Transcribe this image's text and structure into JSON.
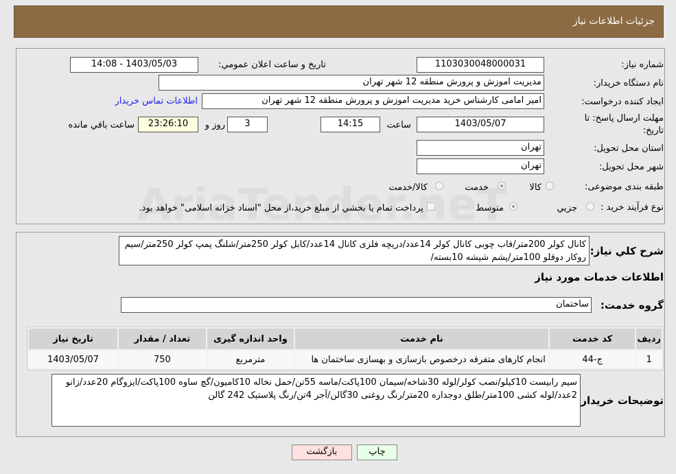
{
  "header": {
    "title": "جزئیات اطلاعات نیاز"
  },
  "fields": {
    "need_number_label": "شماره نیاز:",
    "need_number": "1103030048000031",
    "announce_label": "تاریخ و ساعت اعلان عمومي:",
    "announce_value": "1403/05/03 - 14:08",
    "buyer_label": "نام دستگاه خريدار:",
    "buyer_value": "مدیریت اموزش و پرورش منطقه 12 شهر تهران",
    "creator_label": "ايجاد كننده درخواست:",
    "creator_value": "امیر امامی کارشناس خرید مدیریت اموزش و پرورش منطقه 12 شهر تهران",
    "contact_link": "اطلاعات تماس خريدار",
    "deadline_label_1": "مهلت ارسال پاسخ: تا",
    "deadline_label_2": "تاريخ:",
    "deadline_date": "1403/05/07",
    "time_label": "ساعت",
    "deadline_time": "14:15",
    "days": "3",
    "days_label": "روز و",
    "remaining": "23:26:10",
    "remaining_label": "ساعت باقي مانده",
    "province_label": "استان محل تحويل:",
    "province": "تهران",
    "city_label": "شهر محل تحويل:",
    "city": "تهران",
    "category_label": "طبقه بندی موضوعی:",
    "category_options": [
      "کالا",
      "خدمت",
      "کالا/خدمت"
    ],
    "category_selected": "خدمت",
    "purchase_label": "نوع فرآيند خريد :",
    "purchase_options": [
      "جزيي",
      "متوسط"
    ],
    "purchase_selected": "متوسط",
    "payment_note": "پرداخت تمام يا بخشي از مبلغ خريد،از محل \"اسناد خزانه اسلامی\" خواهد بود.",
    "payment_checked": false
  },
  "watermark": "AriaTender.neT",
  "description": {
    "label": "شرح کلي نياز:",
    "value": "کانال کولر 200متر/قاب چوبی کانال کولر 14عدد/دریچه فلزی کانال 14عدد/کابل کولر 250متر/شلنگ پمپ کولر 250متر/سیم روکار دوقلو 100متر/پشم شیشه 10بسته/"
  },
  "services": {
    "section_title": "اطلاعات خدمات مورد نياز",
    "group_label": "گروه خدمت:",
    "group_value": "ساختمان",
    "columns": [
      "رديف",
      "کد خدمت",
      "نام خدمت",
      "واحد اندازه گيری",
      "تعداد / مقدار",
      "تاريخ نياز"
    ],
    "rows": [
      [
        "1",
        "ج-44",
        "انجام کارهای متفرقه درخصوص بازسازی و بهسازی ساختمان ها",
        "مترمربع",
        "750",
        "1403/05/07"
      ]
    ]
  },
  "notes": {
    "label": "توضيحات خريدار:",
    "value": "سیم رابیست 10کیلو/نصب کولر/لوله 30شاخه/سیمان 100پاکت/ماسه 55تن/حمل نخاله 10کامیون/گچ ساوه 100پاکت/ایزوگام 20عدد/زانو 2عدد/لوله کشی 100متر/طلق دوجداره 20متر/رنگ روغنی 30گالن/آجر 4تن/رنگ پلاستیک 242 گالن"
  },
  "buttons": {
    "print": "چاپ",
    "back": "بازگشت"
  }
}
